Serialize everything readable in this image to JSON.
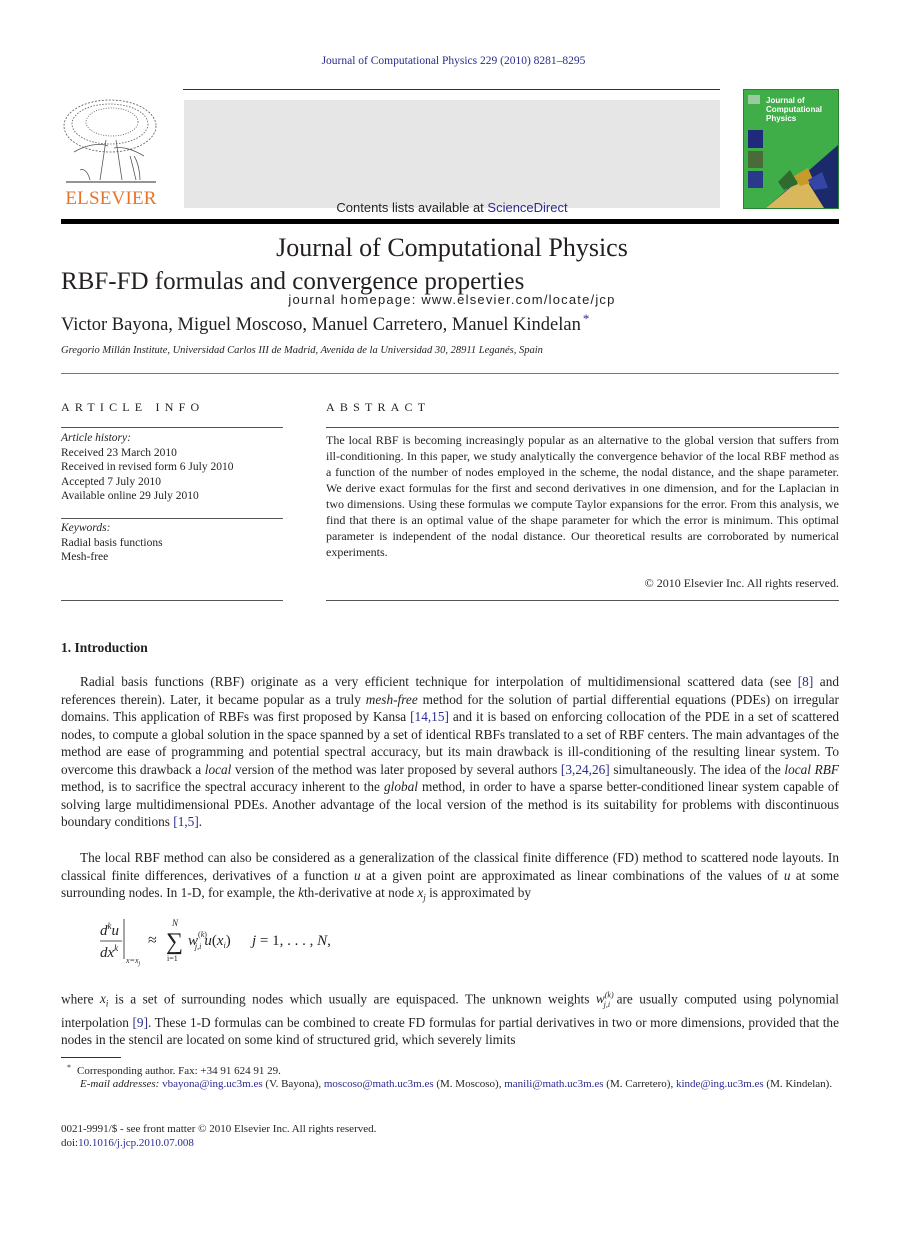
{
  "header": {
    "citation": "Journal of Computational Physics 229 (2010) 8281–8295",
    "contents_prefix": "Contents lists available at ",
    "contents_link": "ScienceDirect",
    "journal_name": "Journal of Computational Physics",
    "homepage": "journal homepage: www.elsevier.com/locate/jcp",
    "publisher_logo_text": "ELSEVIER",
    "cover_title": [
      "Journal of",
      "Computational",
      "Physics"
    ]
  },
  "article": {
    "title": "RBF-FD formulas and convergence properties",
    "authors": "Victor Bayona, Miguel Moscoso, Manuel Carretero, Manuel Kindelan",
    "author_mark": "*",
    "affiliation": "Gregorio Millán Institute, Universidad Carlos III de Madrid, Avenida de la Universidad 30, 28911 Leganés, Spain"
  },
  "article_info": {
    "heading": "ARTICLE INFO",
    "history_label": "Article history:",
    "history": [
      "Received 23 March 2010",
      "Received in revised form 6 July 2010",
      "Accepted 7 July 2010",
      "Available online 29 July 2010"
    ],
    "keywords_label": "Keywords:",
    "keywords": [
      "Radial basis functions",
      "Mesh-free"
    ]
  },
  "abstract": {
    "heading": "ABSTRACT",
    "text": "The local RBF is becoming increasingly popular as an alternative to the global version that suffers from ill-conditioning. In this paper, we study analytically the convergence behavior of the local RBF method as a function of the number of nodes employed in the scheme, the nodal distance, and the shape parameter. We derive exact formulas for the first and second derivatives in one dimension, and for the Laplacian in two dimensions. Using these formulas we compute Taylor expansions for the error. From this analysis, we find that there is an optimal value of the shape parameter for which the error is minimum. This optimal parameter is independent of the nodal distance. Our theoretical results are corroborated by numerical experiments.",
    "copyright": "© 2010 Elsevier Inc. All rights reserved."
  },
  "intro": {
    "heading": "1. Introduction",
    "p1": [
      {
        "t": "Radial basis functions (RBF) originate as a very efficient technique for interpolation of multidimensional scattered data (see "
      },
      {
        "t": "[8]",
        "link": true
      },
      {
        "t": " and references therein). Later, it became popular as a truly "
      },
      {
        "t": "mesh-free",
        "em": true
      },
      {
        "t": " method for the solution of partial differential equations (PDEs) on irregular domains. This application of RBFs was first proposed by Kansa "
      },
      {
        "t": "[14,15]",
        "link": true
      },
      {
        "t": " and it is based on enforcing collocation of the PDE in a set of scattered nodes, to compute a global solution in the space spanned by a set of identical RBFs translated to a set of RBF centers. The main advantages of the method are ease of programming and potential spectral accuracy, but its main drawback is ill-conditioning of the resulting linear system. To overcome this drawback a "
      },
      {
        "t": "local",
        "em": true
      },
      {
        "t": " version of the method was later proposed by several authors "
      },
      {
        "t": "[3,24,26]",
        "link": true
      },
      {
        "t": " simultaneously. The idea of the "
      },
      {
        "t": "local RBF",
        "em": true
      },
      {
        "t": " method, is to sacrifice the spectral accuracy inherent to the "
      },
      {
        "t": "global",
        "em": true
      },
      {
        "t": " method, in order to have a sparse better-conditioned linear system capable of solving large multidimensional PDEs. Another advantage of the local version of the method is its suitability for problems with discontinuous boundary conditions "
      },
      {
        "t": "[1,5]",
        "link": true
      },
      {
        "t": "."
      }
    ],
    "p2": [
      {
        "t": "The local RBF method can also be considered as a generalization of the classical finite difference (FD) method to scattered node layouts. In classical finite differences, derivatives of a function "
      },
      {
        "t": "u",
        "em": true
      },
      {
        "t": " at a given point are approximated as linear combinations of the values of "
      },
      {
        "t": "u",
        "em": true
      },
      {
        "t": " at some surrounding nodes. In 1-D, for example, the "
      },
      {
        "t": "k",
        "em": true
      },
      {
        "t": "th-derivative at node "
      },
      {
        "t": "x_j",
        "em": true,
        "sub": true
      },
      {
        "t": " is approximated by"
      }
    ],
    "equation": {
      "lhs_num": "d^k u",
      "lhs_den": "dx^k",
      "eval_at": "x=x_j",
      "approx": "≈",
      "sum_upper": "N",
      "sum_lower": "i=1",
      "term": "w_{j,i}^{(k)} u(x_i)",
      "range": "j = 1, . . . , N,"
    },
    "p3": [
      {
        "t": "where "
      },
      {
        "t": "x_i",
        "em": true,
        "sub": true
      },
      {
        "t": " is a set of surrounding nodes which usually are equispaced. The unknown weights "
      },
      {
        "t": "w_{j,i}^{(k)}",
        "em": true,
        "weight": true
      },
      {
        "t": " are usually computed using polynomial interpolation "
      },
      {
        "t": "[9]",
        "link": true
      },
      {
        "t": ". These 1-D formulas can be combined to create FD formulas for partial derivatives in two or more dimensions, provided that the nodes in the stencil are located on some kind of structured grid, which severely limits"
      }
    ]
  },
  "footnotes": {
    "star_mark": "*",
    "corresponding": "Corresponding author. Fax: +34 91 624 91 29.",
    "email_label": "E-mail addresses:",
    "emails": [
      {
        "address": "vbayona@ing.uc3m.es",
        "name": "(V. Bayona)"
      },
      {
        "address": "moscoso@math.uc3m.es",
        "name": "(M. Moscoso)"
      },
      {
        "address": "manili@math.uc3m.es",
        "name": "(M. Carretero)"
      },
      {
        "address": "kinde@ing.uc3m.es",
        "name": "(M. Kindelan)."
      }
    ],
    "front_matter": "0021-9991/$ - see front matter © 2010 Elsevier Inc. All rights reserved.",
    "doi_label": "doi:",
    "doi": "10.1016/j.jcp.2010.07.008"
  },
  "colors": {
    "link": "#2b2b8f",
    "elsevier_orange": "#e8742a",
    "banner_bg": "#e6e6e6",
    "cover_green": "#3fae49"
  }
}
